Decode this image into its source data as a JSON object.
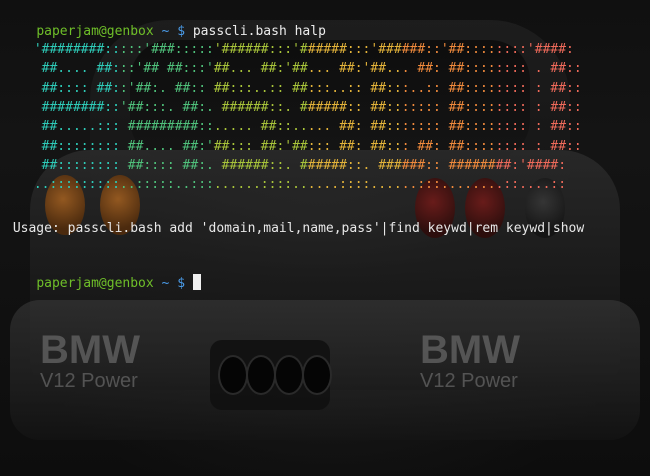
{
  "terminal": {
    "prompt_user": "paperjam@genbox",
    "prompt_path": " ~ $ ",
    "command": "passcli.bash halp",
    "usage": " Usage: passcli.bash add 'domain,mail,name,pass'|find keywd|rem keywd|show",
    "prompt2_user": "paperjam@genbox",
    "prompt2_path": " ~ $ "
  },
  "banner": {
    "rows": [
      " '########:::::'###:::::'######:::'######:::'######::'##::::::::'####:",
      "  ##.... ##:::'## ##:::'##... ##:'##... ##:'##... ##: ##:::::::: . ##::",
      "  ##:::: ##::'##:. ##:: ##:::..:: ##:::..:: ##:::..:: ##:::::::: : ##::",
      "  ########::'##:::. ##:. ######::. ######:: ##::::::: ##:::::::: : ##::",
      "  ##.....::: #########::..... ##::..... ##: ##::::::: ##:::::::: : ##::",
      "  ##:::::::: ##.... ##:'##::: ##:'##::: ##: ##::: ##: ##:::::::: : ##::",
      "  ##:::::::: ##:::: ##:. ######::. ######::. ######:: ########:'####:",
      " ..:::::::::..:::::..:::......::::......::::......:::........::....::"
    ],
    "palette": [
      "#2ecbb8",
      "#4fc17b",
      "#a8c43a",
      "#e3b33a",
      "#f08a3c",
      "#ef6a5a"
    ]
  },
  "backdrop": {
    "brand_left": "BMW",
    "brand_left_sub": "V12 Power",
    "brand_right": "BMW",
    "brand_right_sub": "V12 Power"
  }
}
